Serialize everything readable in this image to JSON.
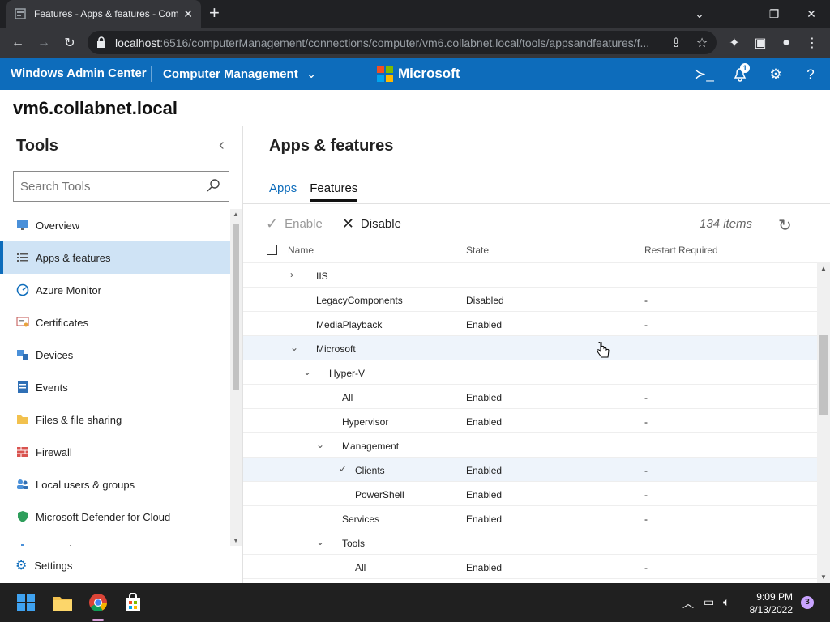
{
  "browser": {
    "tab_title": "Features - Apps & features - Com",
    "url_host": "localhost",
    "url_rest": ":6516/computerManagement/connections/computer/vm6.collabnet.local/tools/appsandfeatures/f..."
  },
  "header": {
    "brand": "Windows Admin Center",
    "context": "Computer Management",
    "vendor": "Microsoft",
    "notification_count": "1",
    "accent": "#0d6cbb"
  },
  "server_name": "vm6.collabnet.local",
  "tools": {
    "title": "Tools",
    "search_placeholder": "Search Tools",
    "items": [
      {
        "label": "Overview",
        "icon": "overview-icon"
      },
      {
        "label": "Apps & features",
        "icon": "list-icon",
        "active": true
      },
      {
        "label": "Azure Monitor",
        "icon": "azure-monitor-icon"
      },
      {
        "label": "Certificates",
        "icon": "certificate-icon"
      },
      {
        "label": "Devices",
        "icon": "devices-icon"
      },
      {
        "label": "Events",
        "icon": "events-icon"
      },
      {
        "label": "Files & file sharing",
        "icon": "folder-icon"
      },
      {
        "label": "Firewall",
        "icon": "firewall-icon"
      },
      {
        "label": "Local users & groups",
        "icon": "users-icon"
      },
      {
        "label": "Microsoft Defender for Cloud",
        "icon": "shield-icon"
      },
      {
        "label": "Network",
        "icon": "network-icon"
      }
    ],
    "settings_label": "Settings"
  },
  "main": {
    "title": "Apps & features",
    "tabs": [
      {
        "label": "Apps",
        "selected": false
      },
      {
        "label": "Features",
        "selected": true
      }
    ],
    "enable_label": "Enable",
    "disable_label": "Disable",
    "item_count": "134 items",
    "columns": {
      "name": "Name",
      "state": "State",
      "restart": "Restart Required"
    },
    "rows": [
      {
        "name": "IIS",
        "state": "",
        "restart": "",
        "level": 0,
        "expander": "collapsed"
      },
      {
        "name": "LegacyComponents",
        "state": "Disabled",
        "restart": "-",
        "level": 0,
        "expander": "none"
      },
      {
        "name": "MediaPlayback",
        "state": "Enabled",
        "restart": "-",
        "level": 0,
        "expander": "none"
      },
      {
        "name": "Microsoft",
        "state": "",
        "restart": "",
        "level": 0,
        "expander": "expanded",
        "highlight": true
      },
      {
        "name": "Hyper-V",
        "state": "",
        "restart": "",
        "level": 1,
        "expander": "expanded"
      },
      {
        "name": "All",
        "state": "Enabled",
        "restart": "-",
        "level": 2,
        "expander": "none"
      },
      {
        "name": "Hypervisor",
        "state": "Enabled",
        "restart": "-",
        "level": 2,
        "expander": "none"
      },
      {
        "name": "Management",
        "state": "",
        "restart": "",
        "level": 2,
        "expander": "expanded"
      },
      {
        "name": "Clients",
        "state": "Enabled",
        "restart": "-",
        "level": 3,
        "expander": "none",
        "checked": true,
        "highlight": true
      },
      {
        "name": "PowerShell",
        "state": "Enabled",
        "restart": "-",
        "level": 3,
        "expander": "none"
      },
      {
        "name": "Services",
        "state": "Enabled",
        "restart": "-",
        "level": 2,
        "expander": "none"
      },
      {
        "name": "Tools",
        "state": "",
        "restart": "",
        "level": 2,
        "expander": "expanded"
      },
      {
        "name": "All",
        "state": "Enabled",
        "restart": "-",
        "level": 3,
        "expander": "none"
      }
    ]
  },
  "taskbar": {
    "time": "9:09 PM",
    "date": "8/13/2022",
    "notifications": "3"
  }
}
